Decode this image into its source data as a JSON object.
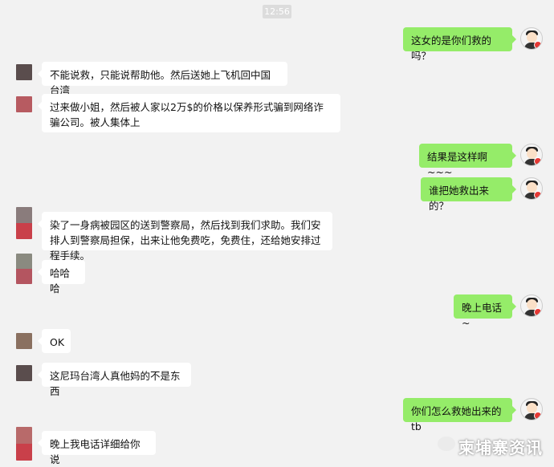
{
  "time_label": "12:56",
  "colors": {
    "sent_bubble": "#95ec69",
    "received_bubble": "#ffffff",
    "background": "#f2f2f2"
  },
  "messages": [
    {
      "side": "right",
      "text": "这女的是你们救的吗？"
    },
    {
      "side": "left",
      "text": "不能说救，只能说帮助他。然后送她上飞机回中国台湾"
    },
    {
      "side": "left",
      "text": "过来做小姐，然后被人家以2万$的价格以保养形式骗到网络诈骗公司。被人集体上"
    },
    {
      "side": "right",
      "text": "结果是这样啊~~~"
    },
    {
      "side": "right",
      "text": "谁把她救出来的？"
    },
    {
      "side": "left",
      "text": "染了一身病被园区的送到警察局，然后找到我们求助。我们安排人到警察局担保，出来让他免费吃，免费住，还给她安排过程手续。"
    },
    {
      "side": "left",
      "text": "哈哈哈"
    },
    {
      "side": "right",
      "text": "晚上电话~"
    },
    {
      "side": "left",
      "text": "OK"
    },
    {
      "side": "left",
      "text": "这尼玛台湾人真他妈的不是东西"
    },
    {
      "side": "right",
      "text": "你们怎么救她出来的tb"
    },
    {
      "side": "left",
      "text": "晚上我电话详细给你说"
    }
  ],
  "watermark_text": "柬埔寨资讯"
}
